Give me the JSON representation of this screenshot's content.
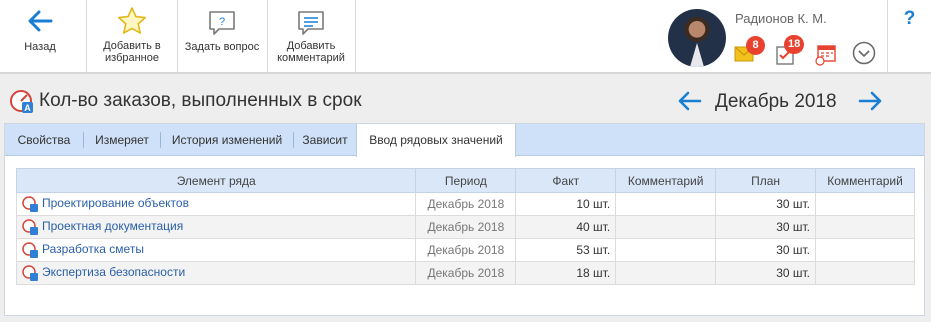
{
  "toolbar": {
    "back_label": "Назад",
    "favorite_label_1": "Добавить в",
    "favorite_label_2": "избранное",
    "ask_label": "Задать вопрос",
    "comment_label_1": "Добавить",
    "comment_label_2": "комментарий",
    "help_label": "?"
  },
  "user": {
    "name": "Радионов К. М.",
    "mail_count": "8",
    "tasks_count": "18"
  },
  "page": {
    "title": "Кол-во заказов, выполненных в срок",
    "period": "Декабрь 2018"
  },
  "tabs": [
    {
      "label": "Свойства"
    },
    {
      "label": "Измеряет"
    },
    {
      "label": "История изменений"
    },
    {
      "label": "Зависит"
    },
    {
      "label": "Ввод рядовых значений"
    }
  ],
  "table": {
    "headers": [
      "Элемент ряда",
      "Период",
      "Факт",
      "Комментарий",
      "План",
      "Комментарий"
    ],
    "rows": [
      {
        "element": "Проектирование объектов",
        "period": "Декабрь 2018",
        "fact": "10 шт.",
        "fact_comment": "",
        "plan": "30 шт.",
        "plan_comment": ""
      },
      {
        "element": "Проектная документация",
        "period": "Декабрь 2018",
        "fact": "40 шт.",
        "fact_comment": "",
        "plan": "30 шт.",
        "plan_comment": ""
      },
      {
        "element": "Разработка сметы",
        "period": "Декабрь 2018",
        "fact": "53 шт.",
        "fact_comment": "",
        "plan": "30 шт.",
        "plan_comment": ""
      },
      {
        "element": "Экспертиза безопасности",
        "period": "Декабрь 2018",
        "fact": "18 шт.",
        "fact_comment": "",
        "plan": "30 шт.",
        "plan_comment": ""
      }
    ]
  },
  "colors": {
    "accent": "#1a7fd4",
    "badge": "#e8412f",
    "tab_bar": "#cfe1f8",
    "link": "#2a5fa8"
  }
}
